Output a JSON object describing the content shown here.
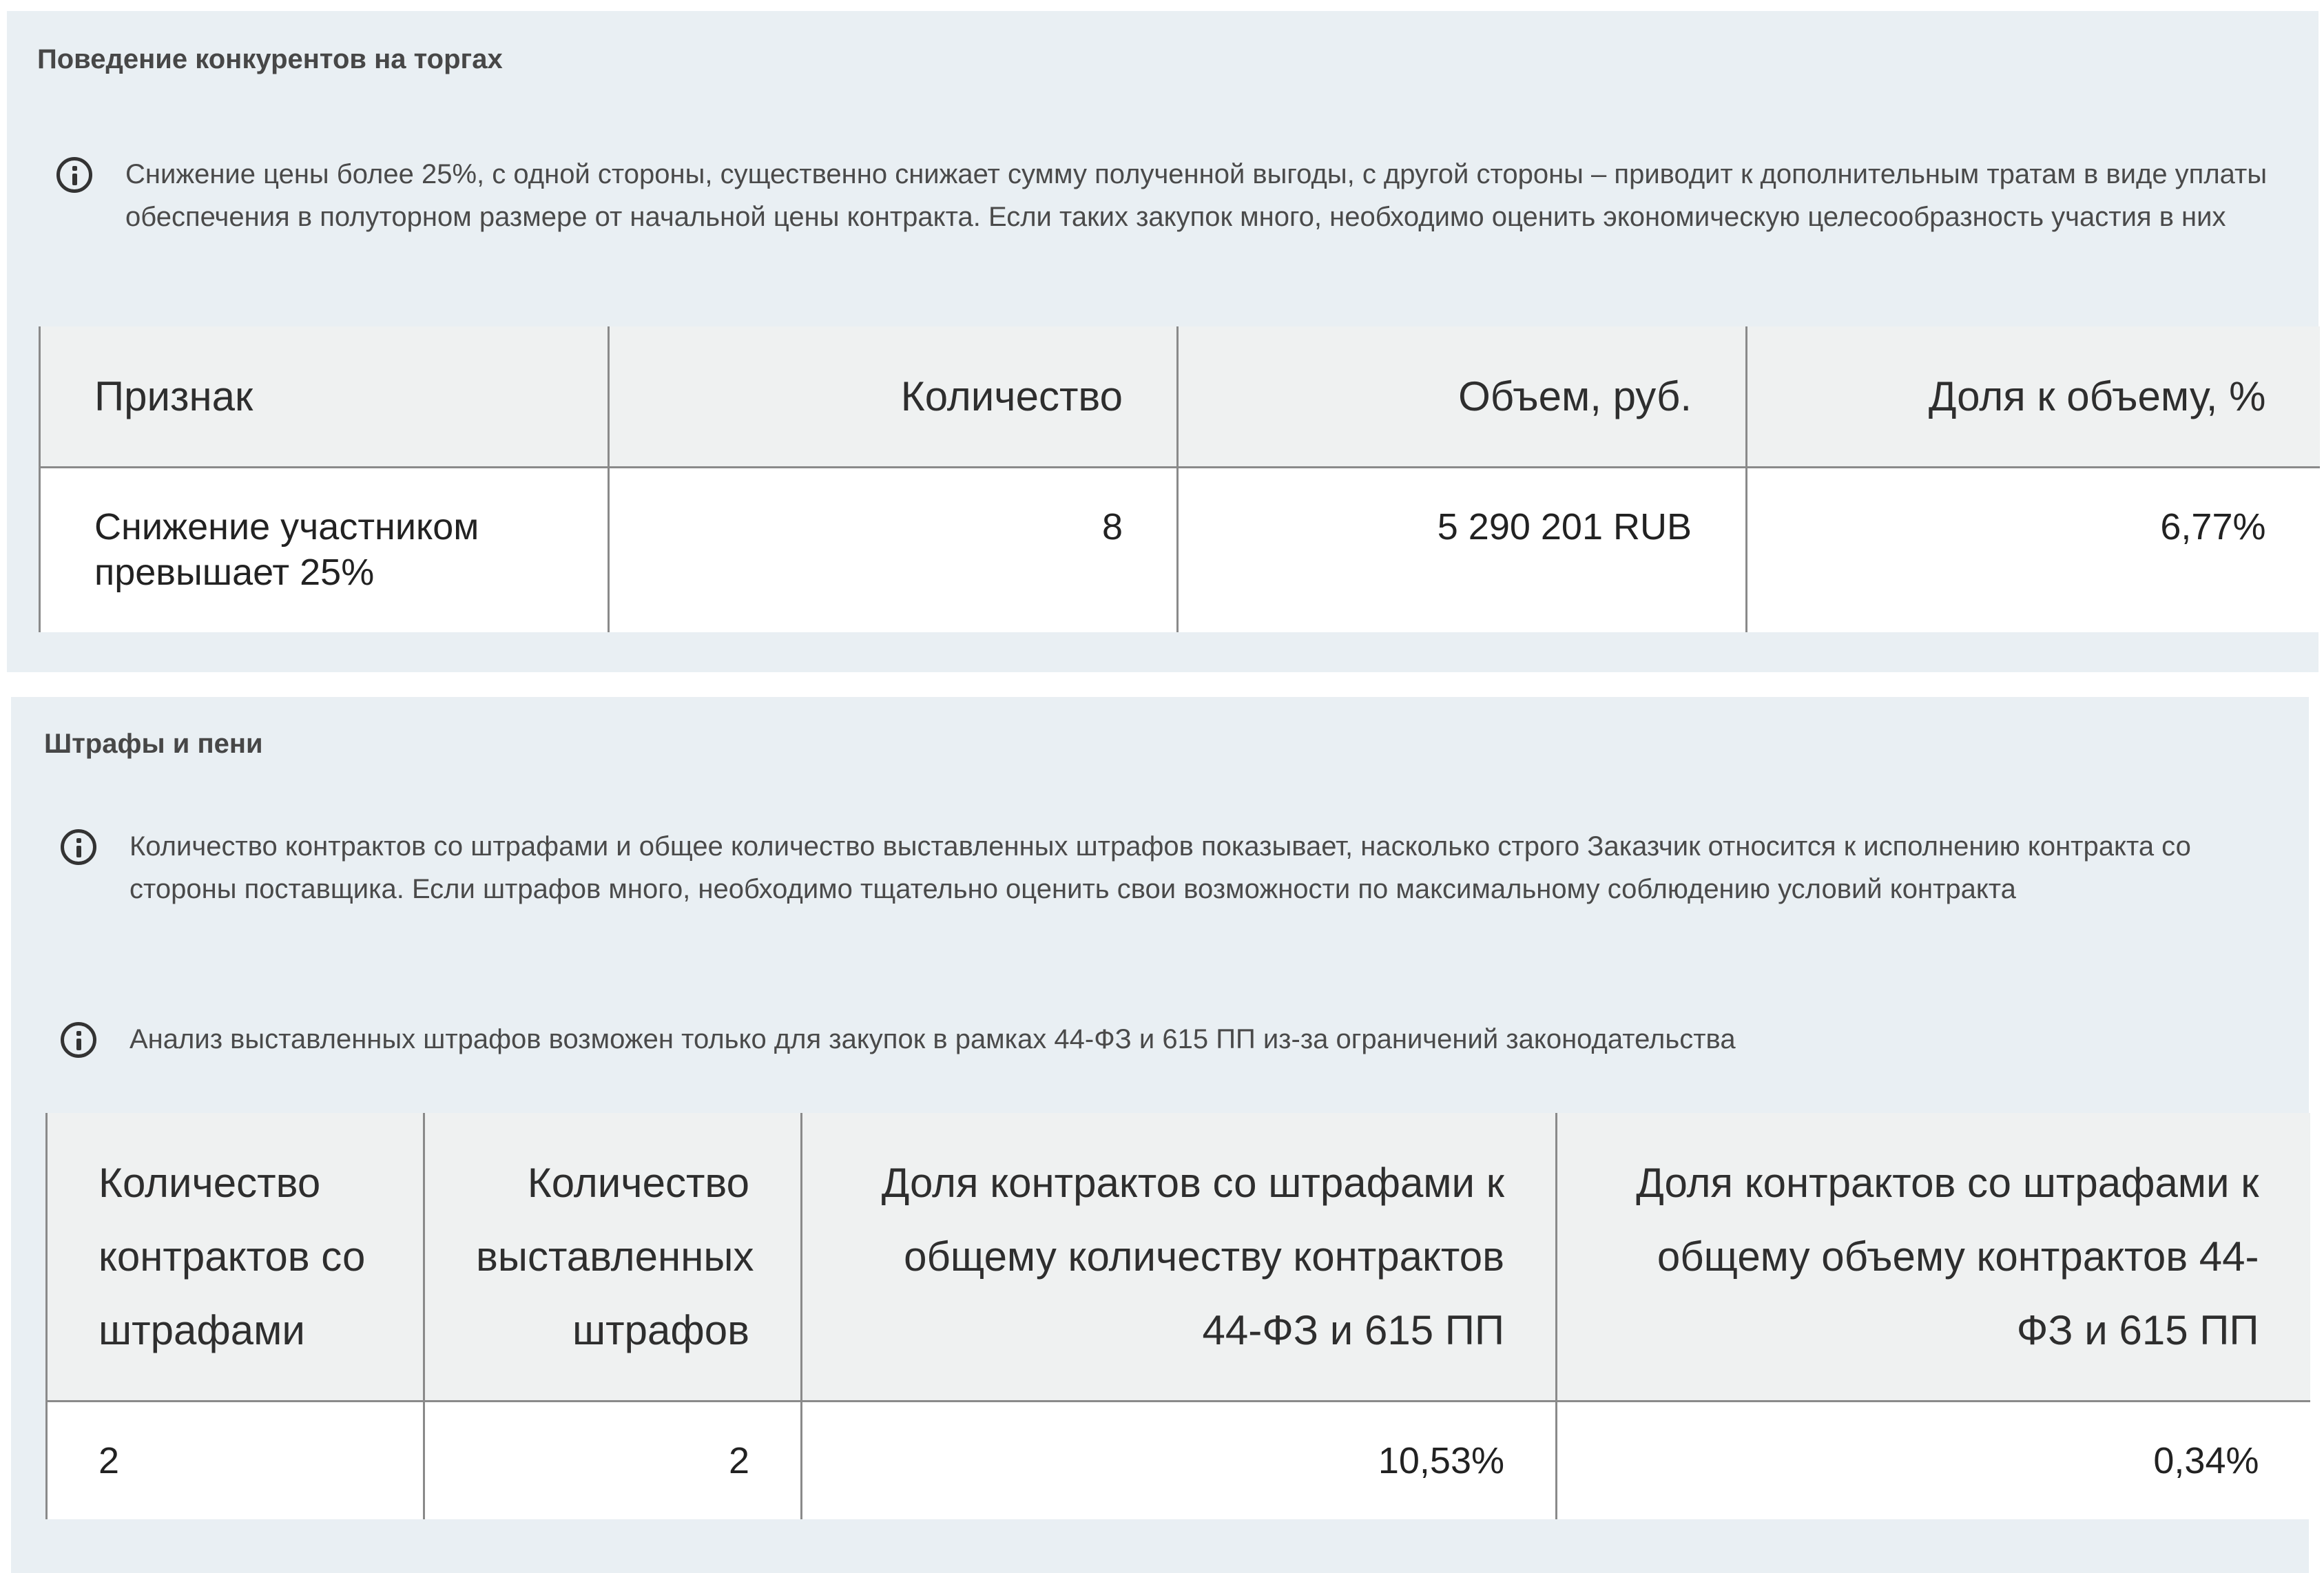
{
  "competitors": {
    "title": "Поведение конкурентов на торгах",
    "info": "Снижение цены более 25%, с одной стороны, существенно снижает сумму полученной выгоды, с другой стороны – приводит к дополнительным тратам в виде уплаты обеспечения в полуторном размере от начальной цены контракта. Если таких закупок много, необходимо оценить экономическую целесообразность участия в них",
    "icon": "info-icon",
    "table": {
      "headers": [
        "Признак",
        "Количество",
        "Объем, руб.",
        "Доля к объему, %"
      ],
      "rows": [
        {
          "feature": "Снижение участником превышает 25%",
          "count": "8",
          "volume": "5 290 201 RUB",
          "share": "6,77%"
        }
      ]
    }
  },
  "fines": {
    "title": "Штрафы и пени",
    "info1": "Количество контрактов со штрафами и общее количество выставленных штрафов показывает, насколько строго Заказчик относится к исполнению контракта со стороны поставщика. Если штрафов много, необходимо тщательно оценить свои возможности по максимальному соблюдению условий контракта",
    "info2": "Анализ выставленных штрафов возможен только для закупок в рамках 44-ФЗ и 615 ПП из-за ограничений законодательства",
    "icon": "info-icon",
    "table": {
      "headers": [
        "Количество контрактов со штрафами",
        "Количество выставленных штрафов",
        "Доля контрактов со штрафами к общему количеству контрактов 44-ФЗ и 615 ПП",
        "Доля контрактов со штрафами к общему объему контрактов 44-ФЗ и 615 ПП"
      ],
      "rows": [
        {
          "contracts_with_fines": "2",
          "fines_issued": "2",
          "share_by_count": "10,53%",
          "share_by_volume": "0,34%"
        }
      ]
    }
  },
  "colors": {
    "section_bg": "#e9eff3",
    "link": "#4a8fa5",
    "negative": "#9b1d21"
  }
}
